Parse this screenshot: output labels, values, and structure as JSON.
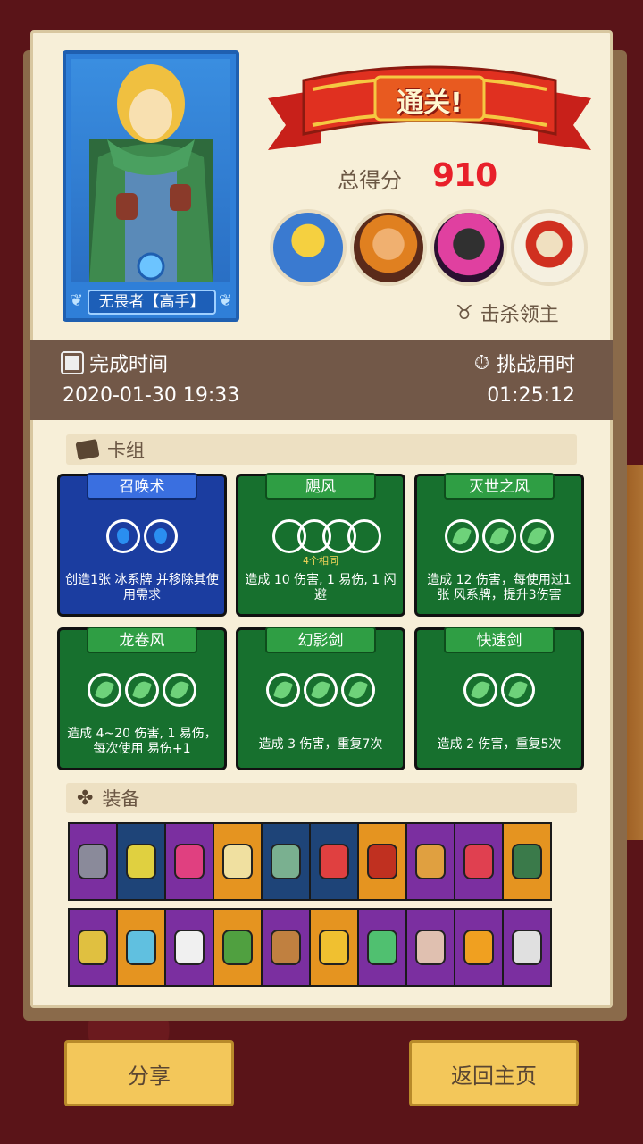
{
  "hero": {
    "name": "无畏者【高手】"
  },
  "banner": {
    "title": "通关!"
  },
  "score": {
    "label": "总得分",
    "value": "910"
  },
  "bosses": [
    "boss-1",
    "boss-2",
    "boss-3",
    "boss-4"
  ],
  "kill_label": "击杀领主",
  "time": {
    "complete_label": "完成时间",
    "complete_value": "2020-01-30 19:33",
    "duration_label": "挑战用时",
    "duration_value": "01:25:12"
  },
  "deck": {
    "title": "卡组",
    "cards": [
      {
        "name": "召唤术",
        "color": "blue",
        "orbs": [
          "drop",
          "drop"
        ],
        "desc": "创造1张 冰系牌 并移除其使用需求"
      },
      {
        "name": "飓风",
        "color": "green",
        "orbs": [
          "empty",
          "empty",
          "empty",
          "empty"
        ],
        "sub": "4个相同",
        "desc": "造成 10 伤害, 1 易伤, 1 闪避"
      },
      {
        "name": "灭世之风",
        "color": "green",
        "orbs": [
          "leaf",
          "leaf",
          "leaf"
        ],
        "desc": "造成 12 伤害，每使用过1张 风系牌，提升3伤害"
      },
      {
        "name": "龙卷风",
        "color": "green",
        "orbs": [
          "leaf",
          "leaf",
          "leaf"
        ],
        "desc": "造成 4~20 伤害, 1 易伤，每次使用 易伤+1"
      },
      {
        "name": "幻影剑",
        "color": "green",
        "orbs": [
          "leaf",
          "leaf",
          "leaf"
        ],
        "desc": "造成 3 伤害，重复7次"
      },
      {
        "name": "快速剑",
        "color": "green",
        "orbs": [
          "leaf",
          "leaf"
        ],
        "desc": "造成 2 伤害，重复5次"
      }
    ]
  },
  "equipment": {
    "title": "装备",
    "row1": [
      "purple",
      "navy",
      "purple",
      "orange",
      "navy",
      "navy",
      "orange",
      "purple",
      "purple",
      "orange"
    ],
    "row2": [
      "purple",
      "orange",
      "purple",
      "orange",
      "purple",
      "orange",
      "purple",
      "purple",
      "purple",
      "purple"
    ]
  },
  "buttons": {
    "share": "分享",
    "home": "返回主页"
  }
}
